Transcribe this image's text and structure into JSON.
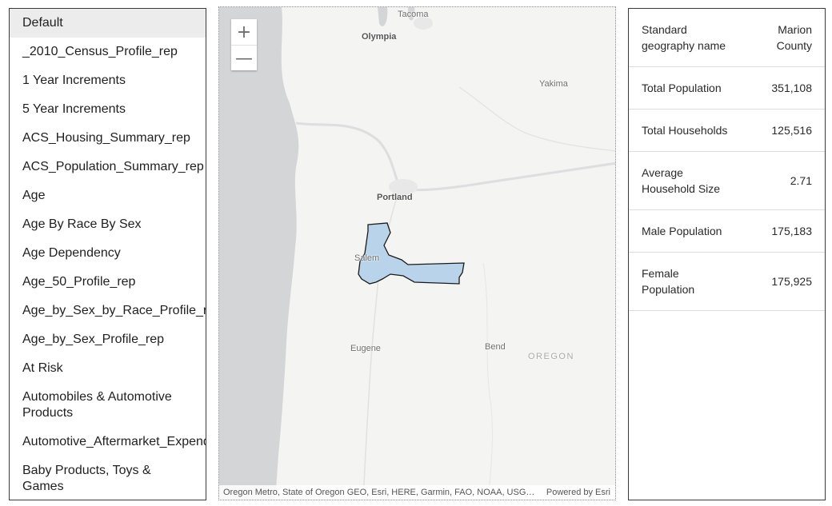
{
  "layer_list": {
    "items": [
      {
        "label": "Default",
        "selected": true
      },
      {
        "label": "_2010_Census_Profile_rep"
      },
      {
        "label": "1 Year Increments"
      },
      {
        "label": "5 Year Increments"
      },
      {
        "label": "ACS_Housing_Summary_rep"
      },
      {
        "label": "ACS_Population_Summary_rep"
      },
      {
        "label": "Age"
      },
      {
        "label": "Age By Race By Sex"
      },
      {
        "label": "Age Dependency"
      },
      {
        "label": "Age_50_Profile_rep"
      },
      {
        "label": "Age_by_Sex_by_Race_Profile_rep"
      },
      {
        "label": "Age_by_Sex_Profile_rep"
      },
      {
        "label": "At Risk"
      },
      {
        "label": "Automobiles & Automotive Products"
      },
      {
        "label": "Automotive_Aftermarket_Expenditures"
      },
      {
        "label": "Baby Products, Toys & Games"
      }
    ]
  },
  "map": {
    "zoom_in_symbol": "+",
    "zoom_out_symbol": "—",
    "labels": {
      "tacoma": "Tacoma",
      "olympia": "Olympia",
      "yakima": "Yakima",
      "portland": "Portland",
      "salem": "Salem",
      "eugene": "Eugene",
      "bend": "Bend",
      "oregon": "OREGON"
    },
    "attribution": "Oregon Metro, State of Oregon GEO, Esri, HERE, Garmin, FAO, NOAA, USGS, EPA",
    "powered_by": "Powered by Esri",
    "colors": {
      "ocean": "#d3d5d6",
      "land": "#f4f4f3",
      "highlight_fill": "#b9d3ea",
      "highlight_outline": "#1a1a1a"
    }
  },
  "stats": {
    "rows": [
      {
        "label": "Standard geography name",
        "value": "Marion County"
      },
      {
        "label": "Total Population",
        "value": "351,108"
      },
      {
        "label": "Total Households",
        "value": "125,516"
      },
      {
        "label": "Average Household Size",
        "value": "2.71"
      },
      {
        "label": "Male Population",
        "value": "175,183"
      },
      {
        "label": "Female Population",
        "value": "175,925"
      }
    ]
  }
}
